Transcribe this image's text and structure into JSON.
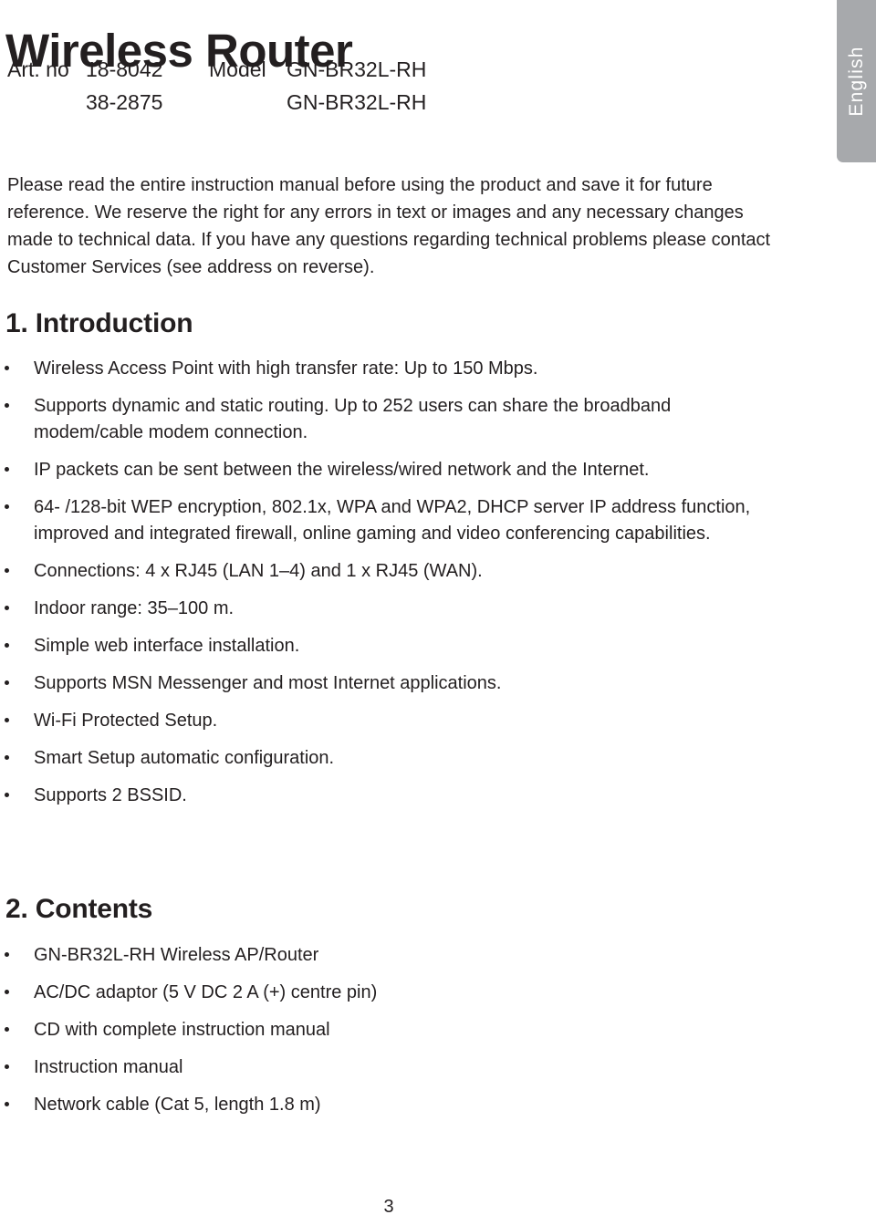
{
  "language_tab": {
    "label": "English",
    "background_color": "#a7a9ac",
    "text_color": "#ffffff"
  },
  "header": {
    "title": "Wireless Router",
    "art_no_label": "Art. no",
    "model_label": "Model",
    "rows": [
      {
        "art_no": "18-8042",
        "model": "GN-BR32L-RH"
      },
      {
        "art_no": "38-2875",
        "model": "GN-BR32L-RH"
      }
    ]
  },
  "intro_paragraph": "Please read the entire instruction manual before using the product and save it for future reference. We reserve the right for any errors in text or images and any necessary changes made to technical data. If you have any questions regarding technical problems please contact Customer Services (see address on reverse).",
  "sections": [
    {
      "number": "1.",
      "title": "Introduction",
      "bullets": [
        "Wireless Access Point with high transfer rate: Up to 150 Mbps.",
        "Supports dynamic and static routing. Up to 252 users can share the broadband modem/cable modem connection.",
        "IP packets can be sent between the wireless/wired network and the Internet.",
        "64- /128-bit WEP encryption, 802.1x, WPA and WPA2, DHCP server IP address function, improved and integrated firewall, online gaming and video conferencing capabilities.",
        "Connections: 4 x RJ45 (LAN 1–4) and 1 x RJ45 (WAN).",
        "Indoor range: 35–100 m.",
        "Simple web interface installation.",
        "Supports MSN Messenger and most Internet applications.",
        "Wi-Fi Protected Setup.",
        "Smart Setup automatic configuration.",
        "Supports 2 BSSID."
      ]
    },
    {
      "number": "2.",
      "title": "Contents",
      "bullets": [
        "GN-BR32L-RH Wireless AP/Router",
        "AC/DC adaptor (5 V DC 2 A (+) centre pin)",
        "CD with complete instruction manual",
        "Instruction manual",
        "Network cable (Cat 5, length 1.8 m)"
      ]
    }
  ],
  "footer": {
    "page_number": "3"
  }
}
